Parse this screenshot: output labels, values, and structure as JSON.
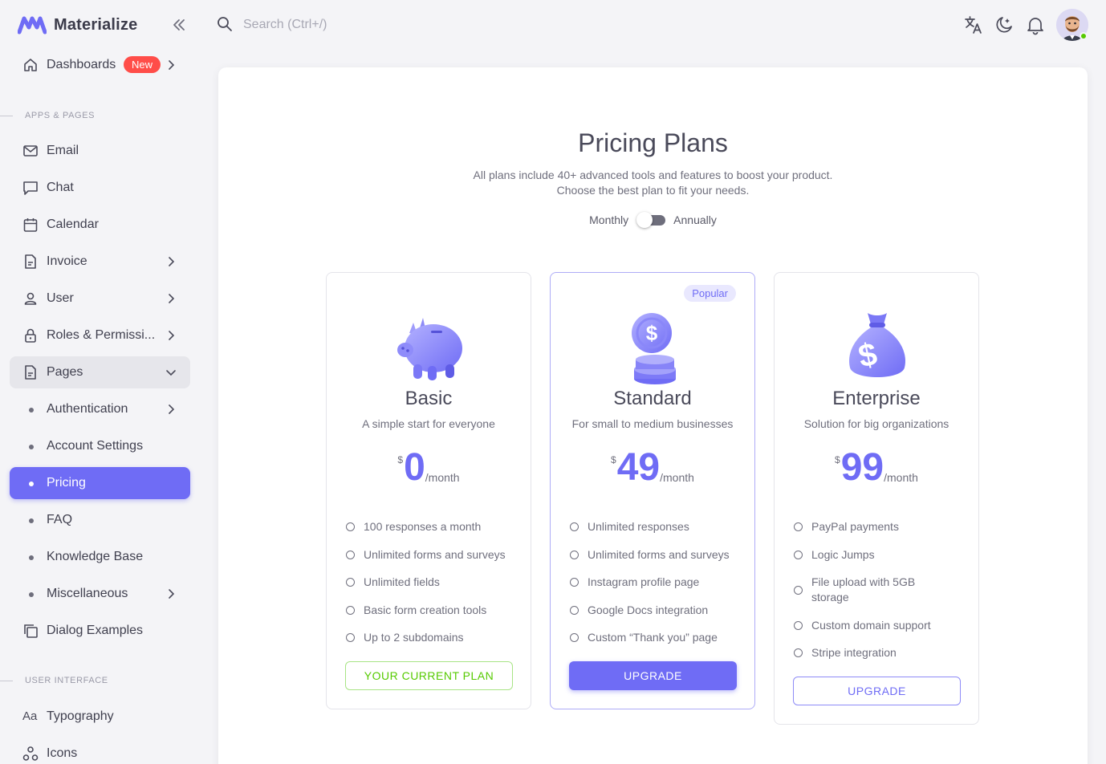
{
  "brand": {
    "name": "Materialize"
  },
  "search": {
    "placeholder": "Search (Ctrl+/)"
  },
  "sidebar": {
    "dashboards": {
      "label": "Dashboards",
      "badge": "New"
    },
    "sections": {
      "apps": "APPS & PAGES",
      "ui": "USER INTERFACE"
    },
    "items": {
      "email": "Email",
      "chat": "Chat",
      "calendar": "Calendar",
      "invoice": "Invoice",
      "user": "User",
      "roles": "Roles & Permissi...",
      "pages": "Pages",
      "authentication": "Authentication",
      "account_settings": "Account Settings",
      "pricing": "Pricing",
      "faq": "FAQ",
      "knowledge_base": "Knowledge Base",
      "miscellaneous": "Miscellaneous",
      "dialog_examples": "Dialog Examples",
      "typography": "Typography",
      "icons": "Icons"
    }
  },
  "pricing": {
    "title": "Pricing Plans",
    "subtitle_1": "All plans include 40+ advanced tools and features to boost your product.",
    "subtitle_2": "Choose the best plan to fit your needs.",
    "toggle_left": "Monthly",
    "toggle_right": "Annually",
    "plans": [
      {
        "name": "Basic",
        "desc": "A simple start for everyone",
        "currency": "$",
        "price": "0",
        "period": "/month",
        "features": [
          "100 responses a month",
          "Unlimited forms and surveys",
          "Unlimited fields",
          "Basic form creation tools",
          "Up to 2 subdomains"
        ],
        "button": "YOUR CURRENT PLAN"
      },
      {
        "name": "Standard",
        "badge": "Popular",
        "desc": "For small to medium businesses",
        "currency": "$",
        "price": "49",
        "period": "/month",
        "features": [
          "Unlimited responses",
          "Unlimited forms and surveys",
          "Instagram profile page",
          "Google Docs integration",
          "Custom “Thank you” page"
        ],
        "button": "UPGRADE"
      },
      {
        "name": "Enterprise",
        "desc": "Solution for big organizations",
        "currency": "$",
        "price": "99",
        "period": "/month",
        "features": [
          "PayPal payments",
          "Logic Jumps",
          "File upload with 5GB storage",
          "Custom domain support",
          "Stripe integration"
        ],
        "button": "UPGRADE"
      }
    ]
  },
  "colors": {
    "primary": "#6f6cf5",
    "success": "#56ca00",
    "danger": "#ff4d49"
  },
  "icons": [
    "brand-logo-icon",
    "collapse-icon",
    "search-icon",
    "translate-icon",
    "moon-icon",
    "bell-icon"
  ]
}
